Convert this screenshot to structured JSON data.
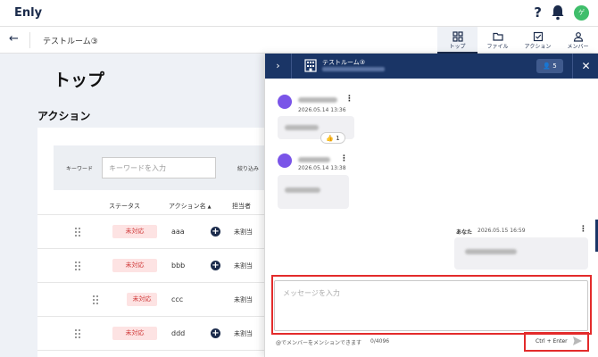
{
  "app": {
    "logo": "Enly",
    "avatar_initial": "ゲ"
  },
  "subheader": {
    "room_title": "テストルーム③",
    "tabs": [
      {
        "label": "トップ",
        "icon": "grid-icon",
        "active": true
      },
      {
        "label": "ファイル",
        "icon": "folder-icon",
        "active": false
      },
      {
        "label": "アクション",
        "icon": "checkbox-icon",
        "active": false
      },
      {
        "label": "メンバー",
        "icon": "person-icon",
        "active": false
      }
    ]
  },
  "main": {
    "page_title": "トップ",
    "section_title": "アクション",
    "filter": {
      "keyword_label": "キーワード",
      "keyword_placeholder": "キーワードを入力",
      "narrow_label": "絞り込み"
    },
    "columns": {
      "status": "ステータス",
      "action_name": "アクション名",
      "sort_indicator": "▲",
      "assignee": "担当者"
    },
    "rows": [
      {
        "status": "未対応",
        "name": "aaa",
        "assignee": "未割当"
      },
      {
        "status": "未対応",
        "name": "bbb",
        "assignee": "未割当"
      },
      {
        "status": "未対応",
        "name": "ccc",
        "assignee": "未割当"
      },
      {
        "status": "未対応",
        "name": "ddd",
        "assignee": "未割当"
      }
    ]
  },
  "chat": {
    "title": "テストルーム③",
    "member_count": "5",
    "messages": [
      {
        "time": "2026.05.14 13:36",
        "reaction_count": "1"
      },
      {
        "time": "2026.05.14 13:38"
      }
    ],
    "own_message": {
      "author": "あなた",
      "time": "2026.05.15 16:59"
    },
    "input_placeholder": "メッセージを入力",
    "mention_hint": "@でメンバーをメンションできます",
    "char_count": "0/4096",
    "send_hint": "Ctrl + Enter"
  },
  "colors": {
    "navy": "#1a3566",
    "status_bg": "#fde3e3",
    "status_text": "#d13b3b",
    "avatar_green": "#3fbe6b",
    "highlight_red": "#e32b2b"
  }
}
